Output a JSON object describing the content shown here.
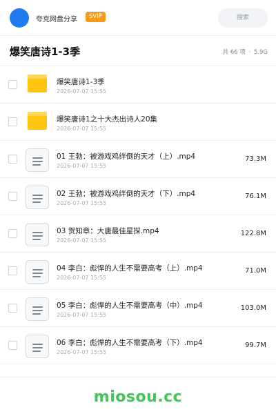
{
  "header": {
    "share_name": "夸克网盘分享",
    "badge": "SVIP",
    "search_placeholder": "搜索"
  },
  "folder": {
    "title": "爆笑唐诗1-3季",
    "count_label": "共 66 项",
    "separator": "·",
    "total_size": "5.9G"
  },
  "files": [
    {
      "type": "folder",
      "icon": "folder-icon",
      "name": "爆笑唐诗1-3季",
      "date": "2026-07-07 15:55",
      "size": ""
    },
    {
      "type": "folder",
      "icon": "folder-icon",
      "name": "爆笑唐诗1之十大杰出诗人20集",
      "date": "2026-07-07 15:55",
      "size": ""
    },
    {
      "type": "video",
      "icon": "document-icon",
      "name": "01 王勃：被游戏鸡绊倒的天才（上）.mp4",
      "date": "2026-07-07 15:55",
      "size": "73.3M"
    },
    {
      "type": "video",
      "icon": "document-icon",
      "name": "02 王勃：被游戏鸡绊倒的天才（下）.mp4",
      "date": "2026-07-07 15:55",
      "size": "76.1M"
    },
    {
      "type": "video",
      "icon": "document-icon",
      "name": "03 贺知章：大唐最佳星探.mp4",
      "date": "2026-07-07 15:55",
      "size": "122.8M"
    },
    {
      "type": "video",
      "icon": "document-icon",
      "name": "04 李白：彪悍的人生不需要高考（上）.mp4",
      "date": "2026-07-07 15:55",
      "size": "71.0M"
    },
    {
      "type": "video",
      "icon": "document-icon",
      "name": "05 李白：彪悍的人生不需要高考（中）.mp4",
      "date": "2026-07-07 15:55",
      "size": "103.0M"
    },
    {
      "type": "video",
      "icon": "document-icon",
      "name": "06 李白：彪悍的人生不需要高考（下）.mp4",
      "date": "2026-07-07 15:55",
      "size": "99.7M"
    }
  ],
  "footer": {
    "watermark": "miosou.cc"
  },
  "colors": {
    "accent": "#1e7bf0",
    "svip": "#f39c1b",
    "folder": "#ffc410",
    "watermark": "#44c35a"
  }
}
